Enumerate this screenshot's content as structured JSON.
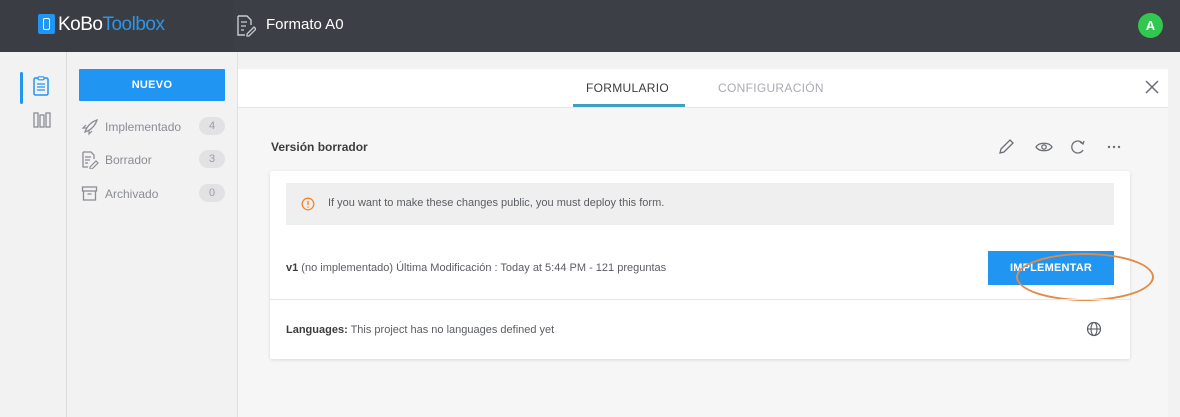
{
  "topbar": {
    "brand_part1": "KoBo",
    "brand_part2": "Toolbox",
    "form_title": "Formato A0",
    "avatar_initial": "A"
  },
  "sidebar": {
    "new_button": "NUEVO",
    "items": [
      {
        "label": "Implementado",
        "count": "4",
        "icon": "rocket-icon"
      },
      {
        "label": "Borrador",
        "count": "3",
        "icon": "draft-icon"
      },
      {
        "label": "Archivado",
        "count": "0",
        "icon": "archive-icon"
      }
    ]
  },
  "tabs": {
    "form": "FORMULARIO",
    "settings": "CONFIGURACIÓN"
  },
  "draft": {
    "title": "Versión borrador",
    "alert": "If you want to make these changes public, you must deploy this form.",
    "version_label": "v1",
    "version_detail": " (no implementado)  Última Modificación : Today at 5:44 PM - 121 preguntas",
    "deploy_button": "IMPLEMENTAR",
    "languages_label": "Languages:",
    "languages_text": " This project has no languages defined yet"
  },
  "colors": {
    "accent": "#2095f2",
    "topbar": "#3c3f46",
    "avatar": "#32c74f",
    "highlight": "#e28a47"
  }
}
